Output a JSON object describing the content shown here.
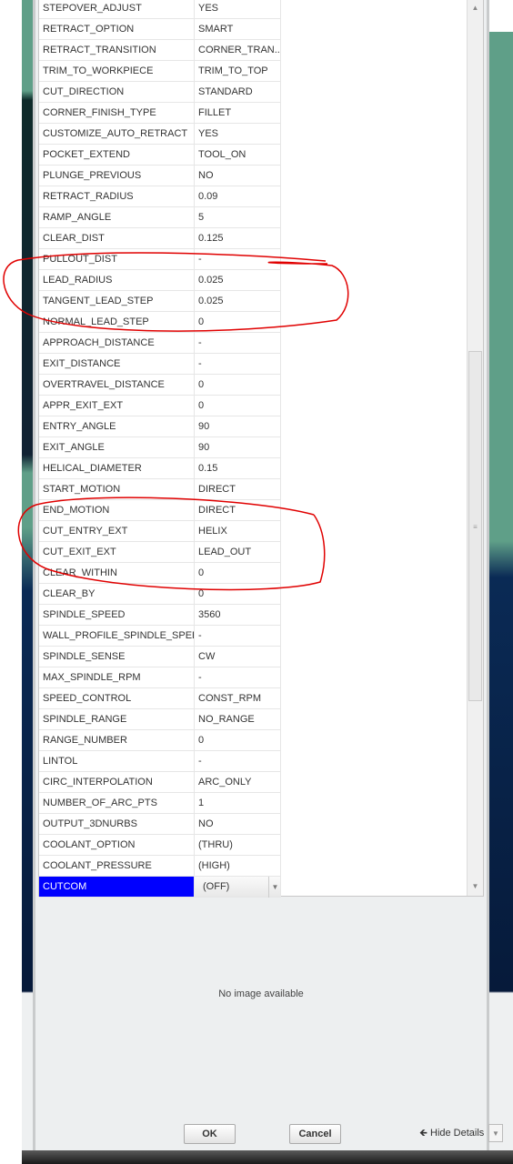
{
  "parameters": [
    [
      "STEPOVER_ADJUST",
      "YES"
    ],
    [
      "RETRACT_OPTION",
      "SMART"
    ],
    [
      "RETRACT_TRANSITION",
      "CORNER_TRAN..."
    ],
    [
      "TRIM_TO_WORKPIECE",
      "TRIM_TO_TOP"
    ],
    [
      "CUT_DIRECTION",
      "STANDARD"
    ],
    [
      "CORNER_FINISH_TYPE",
      "FILLET"
    ],
    [
      "CUSTOMIZE_AUTO_RETRACT",
      "YES"
    ],
    [
      "POCKET_EXTEND",
      "TOOL_ON"
    ],
    [
      "PLUNGE_PREVIOUS",
      "NO"
    ],
    [
      "RETRACT_RADIUS",
      "0.09"
    ],
    [
      "RAMP_ANGLE",
      "5"
    ],
    [
      "CLEAR_DIST",
      "0.125"
    ],
    [
      "PULLOUT_DIST",
      "-"
    ],
    [
      "LEAD_RADIUS",
      "0.025"
    ],
    [
      "TANGENT_LEAD_STEP",
      "0.025"
    ],
    [
      "NORMAL_LEAD_STEP",
      "0"
    ],
    [
      "APPROACH_DISTANCE",
      "-"
    ],
    [
      "EXIT_DISTANCE",
      "-"
    ],
    [
      "OVERTRAVEL_DISTANCE",
      "0"
    ],
    [
      "APPR_EXIT_EXT",
      "0"
    ],
    [
      "ENTRY_ANGLE",
      "90"
    ],
    [
      "EXIT_ANGLE",
      "90"
    ],
    [
      "HELICAL_DIAMETER",
      "0.15"
    ],
    [
      "START_MOTION",
      "DIRECT"
    ],
    [
      "END_MOTION",
      "DIRECT"
    ],
    [
      "CUT_ENTRY_EXT",
      "HELIX"
    ],
    [
      "CUT_EXIT_EXT",
      "LEAD_OUT"
    ],
    [
      "CLEAR_WITHIN",
      "0"
    ],
    [
      "CLEAR_BY",
      "0"
    ],
    [
      "SPINDLE_SPEED",
      "3560"
    ],
    [
      "WALL_PROFILE_SPINDLE_SPEED",
      "-"
    ],
    [
      "SPINDLE_SENSE",
      "CW"
    ],
    [
      "MAX_SPINDLE_RPM",
      "-"
    ],
    [
      "SPEED_CONTROL",
      "CONST_RPM"
    ],
    [
      "SPINDLE_RANGE",
      "NO_RANGE"
    ],
    [
      "RANGE_NUMBER",
      "0"
    ],
    [
      "LINTOL",
      "-"
    ],
    [
      "CIRC_INTERPOLATION",
      "ARC_ONLY"
    ],
    [
      "NUMBER_OF_ARC_PTS",
      "1"
    ],
    [
      "OUTPUT_3DNURBS",
      "NO"
    ],
    [
      "COOLANT_OPTION",
      "(THRU)"
    ],
    [
      "COOLANT_PRESSURE",
      "(HIGH)"
    ],
    [
      "CUTCOM",
      "(OFF)"
    ]
  ],
  "selected_row": "CUTCOM",
  "preview_text": "No image available",
  "buttons": {
    "ok": "OK",
    "cancel": "Cancel",
    "hide_details": "Hide Details"
  },
  "colors": {
    "selection": "#0000ff",
    "annotation": "#e00000"
  }
}
